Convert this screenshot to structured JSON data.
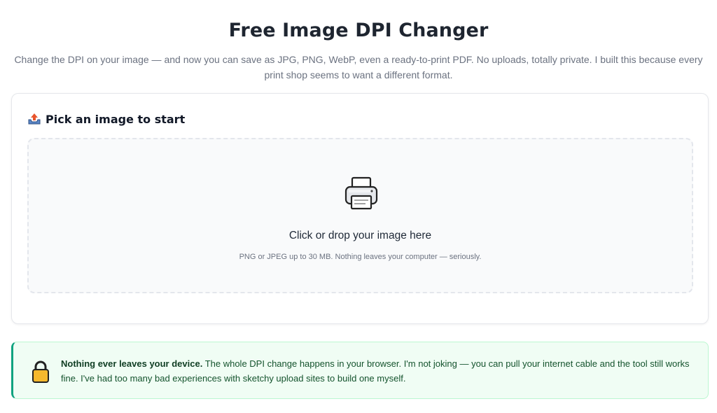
{
  "header": {
    "title": "Free Image DPI Changer",
    "subtitle": "Change the DPI on your image — and now you can save as JPG, PNG, WebP, even a ready-to-print PDF. No uploads, totally private. I built this because every print shop seems to want a different format."
  },
  "picker": {
    "heading": "Pick an image to start",
    "heading_icon": "upload-tray-icon",
    "dropzone": {
      "icon": "printer-icon",
      "main": "Click or drop your image here",
      "sub": "PNG or JPEG up to 30 MB. Nothing leaves your computer — seriously."
    }
  },
  "privacy": {
    "icon": "lock-icon",
    "strong": "Nothing ever leaves your device.",
    "body": " The whole DPI change happens in your browser. I'm not joking — you can pull your internet cable and the tool still works fine. I've had too many bad experiences with sketchy upload sites to build one myself."
  },
  "colors": {
    "accent": "#10a37f",
    "notice_bg": "#f0fdf4",
    "dropzone_bg": "#f9fafb"
  }
}
